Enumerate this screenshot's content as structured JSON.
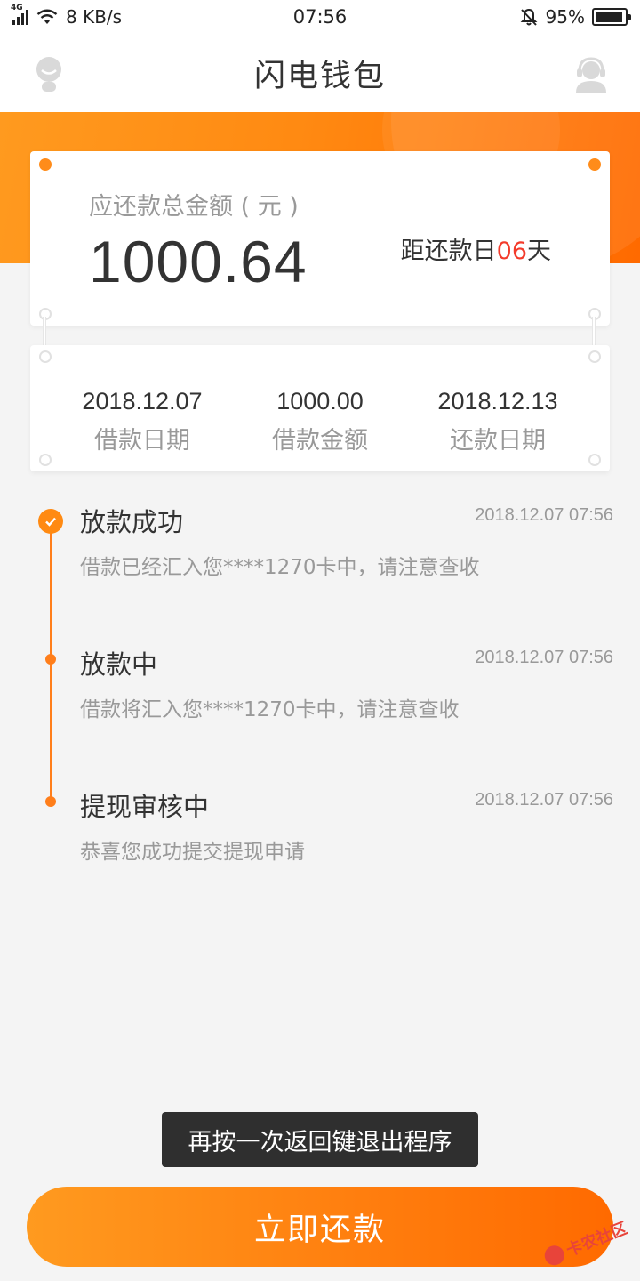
{
  "status_bar": {
    "network_type": "4G",
    "speed": "8 KB/s",
    "time": "07:56",
    "battery": "95%",
    "battery_level": 0.95,
    "icons": [
      "signal-icon",
      "wifi-icon",
      "mute-icon",
      "battery-icon"
    ]
  },
  "nav": {
    "title": "闪电钱包",
    "left_icon": "user-avatar-icon",
    "right_icon": "customer-service-icon"
  },
  "summary": {
    "label": "应还款总金额 ( 元 )",
    "amount": "1000.64",
    "countdown_prefix": "距还款日",
    "countdown_days": "06",
    "countdown_suffix": "天"
  },
  "loan_info": [
    {
      "value": "2018.12.07",
      "label": "借款日期"
    },
    {
      "value": "1000.00",
      "label": "借款金额"
    },
    {
      "value": "2018.12.13",
      "label": "还款日期"
    }
  ],
  "timeline": [
    {
      "title": "放款成功",
      "time": "2018.12.07 07:56",
      "desc": "借款已经汇入您****1270卡中，请注意查收",
      "done": true
    },
    {
      "title": "放款中",
      "time": "2018.12.07 07:56",
      "desc": "借款将汇入您****1270卡中，请注意查收",
      "done": false
    },
    {
      "title": "提现审核中",
      "time": "2018.12.07 07:56",
      "desc": "恭喜您成功提交提现申请",
      "done": false
    }
  ],
  "toast": "再按一次返回键退出程序",
  "repay_button": "立即还款",
  "watermark": "卡农社区",
  "colors": {
    "accent": "#ff8a12",
    "accent_dark": "#ff6a00",
    "countdown_highlight": "#f33b2b"
  }
}
